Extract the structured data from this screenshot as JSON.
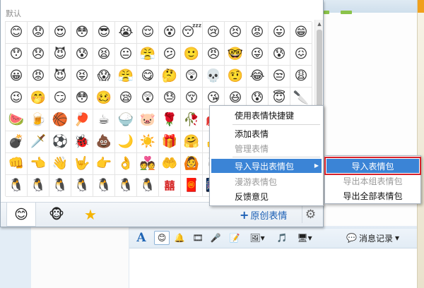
{
  "panel": {
    "title": "默认",
    "emojis": [
      "😊",
      "😟",
      "😍",
      "😳",
      "😎",
      "😭",
      "😌",
      "😵",
      "😴",
      "😢",
      "😣",
      "😡",
      "😛",
      "😁",
      "😯",
      "😞",
      "😈",
      "😰",
      "😫",
      "😐",
      "😤",
      "😕",
      "🙂",
      "😠",
      "🤓",
      "😜",
      "😰",
      "😖",
      "😀",
      "😡",
      "😈",
      "😝",
      "😱",
      "😤",
      "😋",
      "🤔",
      "😲",
      "💀",
      "🤨",
      "😂",
      "😒",
      "😩",
      "😉",
      "🤭",
      "😏",
      "😳",
      "🥴",
      "😪",
      "😲",
      "😓",
      "😚",
      "😘",
      "😆",
      "😰",
      "😇",
      "🔪",
      "🍉",
      "🍺",
      "🏀",
      "🏓",
      "☕",
      "🍚",
      "🐷",
      "🌹",
      "🥀",
      "💋",
      "❤️",
      "💔",
      "🎂",
      "⚡",
      "💣",
      "🗡️",
      "⚽",
      "🐞",
      "💩",
      "🌙",
      "☀️",
      "🎁",
      "🤗",
      "👍",
      "👎",
      "🤝",
      "✌️",
      "🙏",
      "👊",
      "👈",
      "👋",
      "🤟",
      "👉",
      "👌",
      "💑",
      "🤲",
      "🙆",
      "🐧",
      "👋",
      "🧍",
      "🤴",
      "🙅",
      "🐧",
      "🐧",
      "🐧",
      "🐧",
      "🐧",
      "🐧",
      "🐧",
      "囍",
      "🧧",
      "🎆",
      "🐧",
      "🐧",
      "🐧",
      "🐧"
    ]
  },
  "footer": {
    "tabs": [
      {
        "icon": "smiley-icon",
        "glyph": "😊"
      },
      {
        "icon": "monkey-icon",
        "glyph": "🐵"
      },
      {
        "icon": "star-icon",
        "glyph": "★"
      }
    ],
    "create_plus": "+",
    "create_label": "原创表情",
    "gear_glyph": "⚙"
  },
  "menu": {
    "items": [
      {
        "label": "使用表情快捷键",
        "enabled": true
      },
      {
        "label": "添加表情",
        "enabled": true
      },
      {
        "label": "管理表情",
        "enabled": false
      },
      {
        "label": "导入导出表情包",
        "enabled": true,
        "active": true,
        "submenu": true
      },
      {
        "label": "漫游表情包",
        "enabled": false
      },
      {
        "label": "反馈意见",
        "enabled": true
      }
    ]
  },
  "submenu": {
    "items": [
      {
        "label": "导入表情包",
        "enabled": true,
        "active": true
      },
      {
        "label": "导出本组表情包",
        "enabled": false
      },
      {
        "label": "导出全部表情包",
        "enabled": true
      }
    ]
  },
  "toolbar": {
    "font_glyph": "A",
    "smile_glyph": "😊",
    "bell_glyph": "🔔",
    "film_glyph": "🎞",
    "mic_glyph": "🎤",
    "note_glyph": "📝",
    "shot_glyph": "🖼▾",
    "music_glyph": "🎵",
    "screen_glyph": "🖥▾",
    "history_label": "消息记录",
    "history_glyph": "💬",
    "history_arrow": "▾"
  },
  "colors": {
    "accent": "#3b84d6",
    "highlight_outline": "#d6202a",
    "link": "#1b5fb5"
  }
}
